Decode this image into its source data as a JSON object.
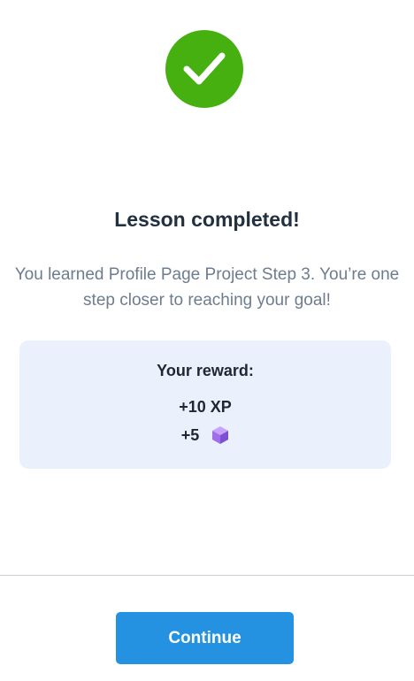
{
  "completion": {
    "icon": "checkmark-icon",
    "icon_color": "#45b010",
    "title": "Lesson completed!",
    "message": "You learned Profile Page Project Step 3. You’re one step closer to reaching your goal!"
  },
  "reward": {
    "title": "Your reward:",
    "xp": "+10 XP",
    "gems": "+5",
    "gem_icon": "gem-cube-icon",
    "gem_color": "#9f6ee8",
    "card_color": "#ebf1fc"
  },
  "footer": {
    "continue_label": "Continue",
    "button_color": "#2492e0"
  }
}
